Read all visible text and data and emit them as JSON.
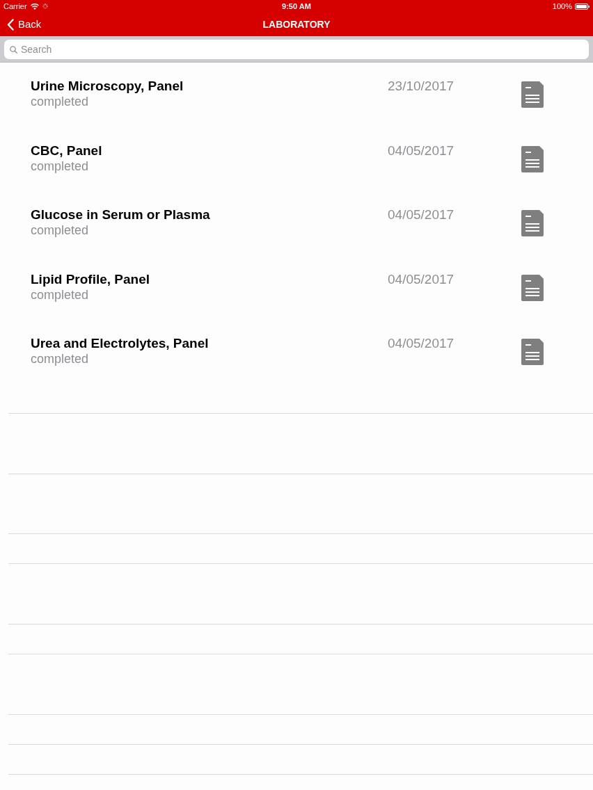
{
  "status_bar": {
    "carrier": "Carrier",
    "time": "9:50 AM",
    "battery": "100%"
  },
  "nav": {
    "back": "Back",
    "title": "LABORATORY"
  },
  "search": {
    "placeholder": "Search"
  },
  "items": [
    {
      "title": "Urine Microscopy, Panel",
      "status": "completed",
      "date": "23/10/2017"
    },
    {
      "title": "CBC, Panel",
      "status": "completed",
      "date": "04/05/2017"
    },
    {
      "title": "Glucose in Serum or Plasma",
      "status": "completed",
      "date": "04/05/2017"
    },
    {
      "title": "Lipid Profile, Panel",
      "status": "completed",
      "date": "04/05/2017"
    },
    {
      "title": "Urea and Electrolytes, Panel",
      "status": "completed",
      "date": "04/05/2017"
    }
  ]
}
